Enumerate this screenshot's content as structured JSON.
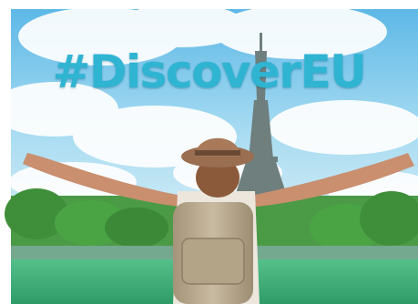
{
  "banner": {
    "hashtag": "#DiscoverEU"
  },
  "colors": {
    "hashtag": "#2fb4d2",
    "sky": "#6fc3ea",
    "grass": "#3fae6a",
    "trees": "#3f8f3a",
    "tower": "#7a8a86",
    "backpack": "#b9a98e",
    "hat": "#a87a5a"
  }
}
